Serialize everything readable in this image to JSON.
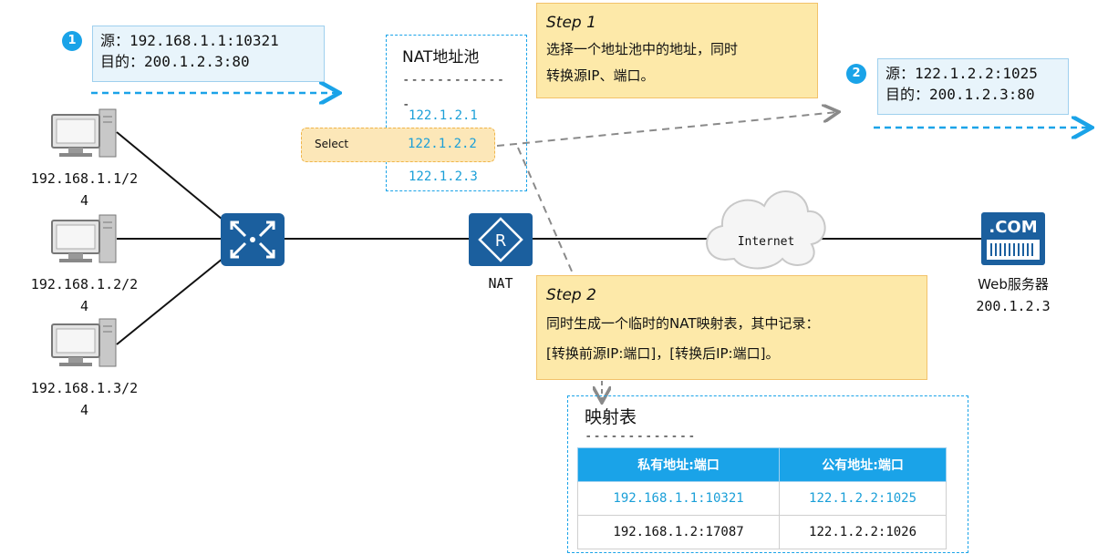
{
  "packet1": {
    "badge": "1",
    "src": "源：192.168.1.1:10321",
    "dst": "目的：200.1.2.3:80"
  },
  "packet2": {
    "badge": "2",
    "src": "源：122.1.2.2:1025",
    "dst": "目的：200.1.2.3:80"
  },
  "nat_pool": {
    "title": "NAT地址池",
    "separator": "------------",
    "dash_tail": "-",
    "addresses": [
      "122.1.2.1",
      "122.1.2.2",
      "122.1.2.3"
    ]
  },
  "select_label": "Select",
  "step1": {
    "title": "Step 1",
    "line1": "选择一个地址池中的地址，同时",
    "line2": "转换源IP、端口。"
  },
  "step2": {
    "title": "Step 2",
    "line1": "同时生成一个临时的NAT映射表，其中记录：",
    "line2": "[转换前源IP:端口]，[转换后IP:端口]。"
  },
  "hosts": [
    {
      "line1": "192.168.1.1/2",
      "line2": "4"
    },
    {
      "line1": "192.168.1.2/2",
      "line2": "4"
    },
    {
      "line1": "192.168.1.3/2",
      "line2": "4"
    }
  ],
  "nat_label": "NAT",
  "internet_label": "Internet",
  "server": {
    "icon_text": ".COM",
    "label1": "Web服务器",
    "label2": "200.1.2.3"
  },
  "mapping": {
    "title": "映射表",
    "separator": "-------------",
    "headers": [
      "私有地址:端口",
      "公有地址:端口"
    ],
    "rows": [
      [
        "192.168.1.1:10321",
        "122.1.2.2:1025"
      ],
      [
        "192.168.1.2:17087",
        "122.1.2.2:1026"
      ]
    ]
  },
  "colors": {
    "accent": "#1aa3e8",
    "device": "#1b5f9e",
    "step_bg": "#fde9a9",
    "info_bg": "#e8f4fb"
  }
}
